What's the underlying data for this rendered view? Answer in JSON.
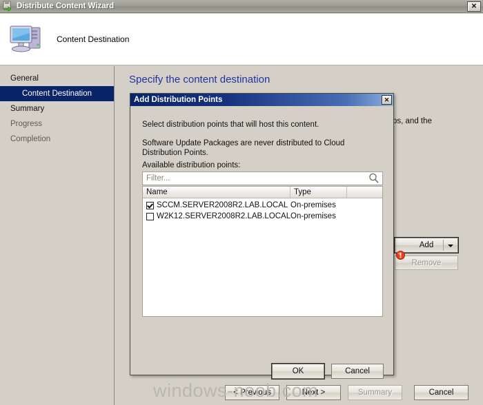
{
  "window": {
    "title": "Distribute Content Wizard",
    "title_icon": "distribute-content-icon",
    "close_label": "✕"
  },
  "header": {
    "icon": "computer-monitor-icon",
    "title": "Content Destination"
  },
  "sidebar": {
    "items": [
      {
        "label": "General",
        "selected": false,
        "indent": false,
        "dim": false
      },
      {
        "label": "Content Destination",
        "selected": true,
        "indent": true,
        "dim": false
      },
      {
        "label": "Summary",
        "selected": false,
        "indent": false,
        "dim": false
      },
      {
        "label": "Progress",
        "selected": false,
        "indent": false,
        "dim": true
      },
      {
        "label": "Completion",
        "selected": false,
        "indent": false,
        "dim": true
      }
    ]
  },
  "main": {
    "heading": "Specify the content destination",
    "background_text_fragment": "ps, and the",
    "add_button": "Add",
    "remove_button": "Remove",
    "error_icon": "error-exclamation-icon"
  },
  "dialog": {
    "title": "Add Distribution Points",
    "close_label": "✕",
    "line1": "Select distribution points that will host this content.",
    "line2": "Software Update Packages are never distributed to Cloud Distribution Points.",
    "available_label": "Available distribution points:",
    "filter": {
      "placeholder": "Filter...",
      "value": "",
      "icon": "search-icon"
    },
    "columns": [
      "Name",
      "Type",
      ""
    ],
    "rows": [
      {
        "checked": true,
        "name": "SCCM.SERVER2008R2.LAB.LOCAL",
        "type": "On-premises"
      },
      {
        "checked": false,
        "name": "W2K12.SERVER2008R2.LAB.LOCAL",
        "type": "On-premises"
      }
    ],
    "ok_label": "OK",
    "cancel_label": "Cancel"
  },
  "footer": {
    "previous_label": "< Previous",
    "next_label": "Next >",
    "summary_label": "Summary",
    "cancel_label": "Cancel"
  },
  "watermark": "windows-noob.com",
  "colors": {
    "dialog_title_start": "#0a246a",
    "heading": "#21329b",
    "selection": "#0a246a",
    "error": "#e8401c",
    "window_bg": "#d4d0c8"
  }
}
